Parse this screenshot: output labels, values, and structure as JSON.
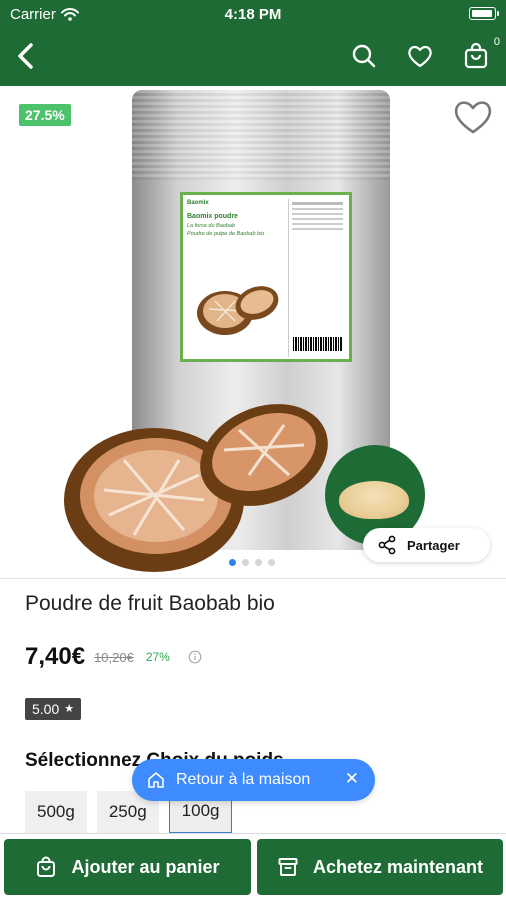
{
  "status_bar": {
    "carrier": "Carrier",
    "time": "4:18 PM"
  },
  "nav": {
    "cart_count": "0",
    "icons": [
      "back-arrow-icon",
      "search-icon",
      "heart-icon",
      "shopping-bag-icon"
    ]
  },
  "gallery": {
    "discount_badge": "27.5%",
    "share_label": "Partager",
    "image_count": 4,
    "active_image": 1,
    "package_label": {
      "brand": "Baomix",
      "product": "Baomix poudre",
      "tagline_1": "La force du Baobab",
      "tagline_2": "Poudre de pulpe de Baobab bio"
    }
  },
  "product": {
    "title": "Poudre de fruit Baobab bio",
    "price": "7,40€",
    "old_price": "10,20€",
    "discount_pct": "27%",
    "rating": "5.00",
    "rating_star": "★"
  },
  "options": {
    "heading": "Sélectionnez Choix du poids",
    "weights": [
      "500g",
      "250g",
      "100g"
    ],
    "selected": "100g"
  },
  "toast": {
    "label": "Retour à la maison",
    "close": "✕"
  },
  "actions": {
    "add_to_cart": "Ajouter au panier",
    "buy_now": "Achetez maintenant"
  },
  "colors": {
    "brand_green": "#1f6b35",
    "discount_green": "#4cc26b",
    "toast_blue": "#3d8bff",
    "dot_active": "#2f80ed"
  }
}
